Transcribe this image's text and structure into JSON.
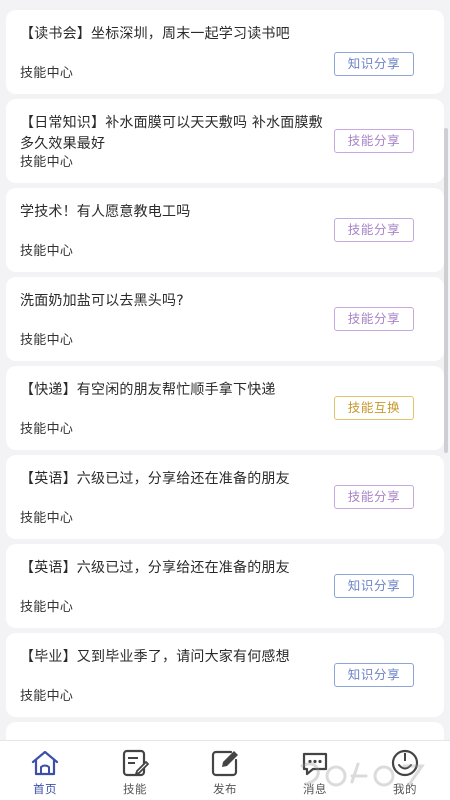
{
  "feed": {
    "cards": [
      {
        "title": "【读书会】坐标深圳，周末一起学习读书吧",
        "meta": "技能中心",
        "tag": "知识分享",
        "tag_style": "blue"
      },
      {
        "title": "【日常知识】补水面膜可以天天敷吗 补水面膜敷多久效果最好",
        "meta": "技能中心",
        "tag": "技能分享",
        "tag_style": "purple"
      },
      {
        "title": "学技术！有人愿意教电工吗",
        "meta": "技能中心",
        "tag": "技能分享",
        "tag_style": "purple"
      },
      {
        "title": "洗面奶加盐可以去黑头吗?",
        "meta": "技能中心",
        "tag": "技能分享",
        "tag_style": "purple"
      },
      {
        "title": "【快递】有空闲的朋友帮忙顺手拿下快递",
        "meta": "技能中心",
        "tag": "技能互换",
        "tag_style": "gold"
      },
      {
        "title": "【英语】六级已过，分享给还在准备的朋友",
        "meta": "技能中心",
        "tag": "技能分享",
        "tag_style": "purple"
      },
      {
        "title": "【英语】六级已过，分享给还在准备的朋友",
        "meta": "技能中心",
        "tag": "知识分享",
        "tag_style": "blue"
      },
      {
        "title": "【毕业】又到毕业季了，请问大家有何感想",
        "meta": "技能中心",
        "tag": "知识分享",
        "tag_style": "blue"
      }
    ]
  },
  "tabbar": {
    "items": [
      {
        "label": "首页",
        "icon": "home-icon",
        "active": true
      },
      {
        "label": "技能",
        "icon": "edit-note-icon",
        "active": false
      },
      {
        "label": "发布",
        "icon": "compose-icon",
        "active": false
      },
      {
        "label": "消息",
        "icon": "message-icon",
        "active": false
      },
      {
        "label": "我的",
        "icon": "profile-icon",
        "active": false
      }
    ]
  },
  "watermark": {
    "text": "9G"
  },
  "colors": {
    "accent": "#3d4fa8",
    "tag_blue": "#6c84c7",
    "tag_purple": "#a784c9",
    "tag_gold": "#c6982c",
    "background": "#f3f3f5"
  }
}
